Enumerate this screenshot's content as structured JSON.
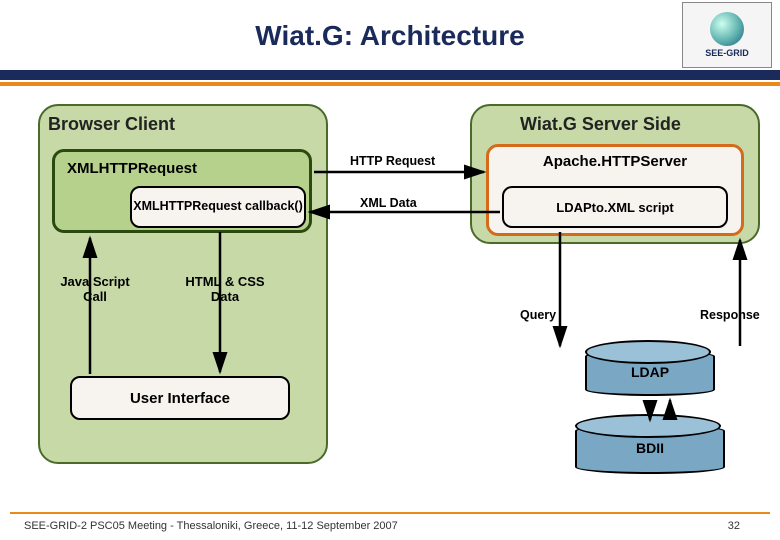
{
  "title": "Wiat.G: Architecture",
  "logo": {
    "name": "SEE-GRID"
  },
  "client": {
    "title": "Browser Client",
    "xhr": "XMLHTTPRequest",
    "callback": "XMLHTTPRequest callback()",
    "js_call": "Java Script Call",
    "html_css": "HTML & CSS Data",
    "ui": "User Interface"
  },
  "server": {
    "title": "Wiat.G Server Side",
    "apache": "Apache.HTTPServer",
    "script": "LDAPto.XML script"
  },
  "flows": {
    "http": "HTTP Request",
    "xml": "XML Data",
    "query": "Query",
    "response": "Response"
  },
  "stores": {
    "ldap": "LDAP",
    "bdii": "BDII"
  },
  "footer": {
    "text": "SEE-GRID-2 PSC05 Meeting - Thessaloniki, Greece, 11-12 September 2007",
    "page": "32"
  }
}
